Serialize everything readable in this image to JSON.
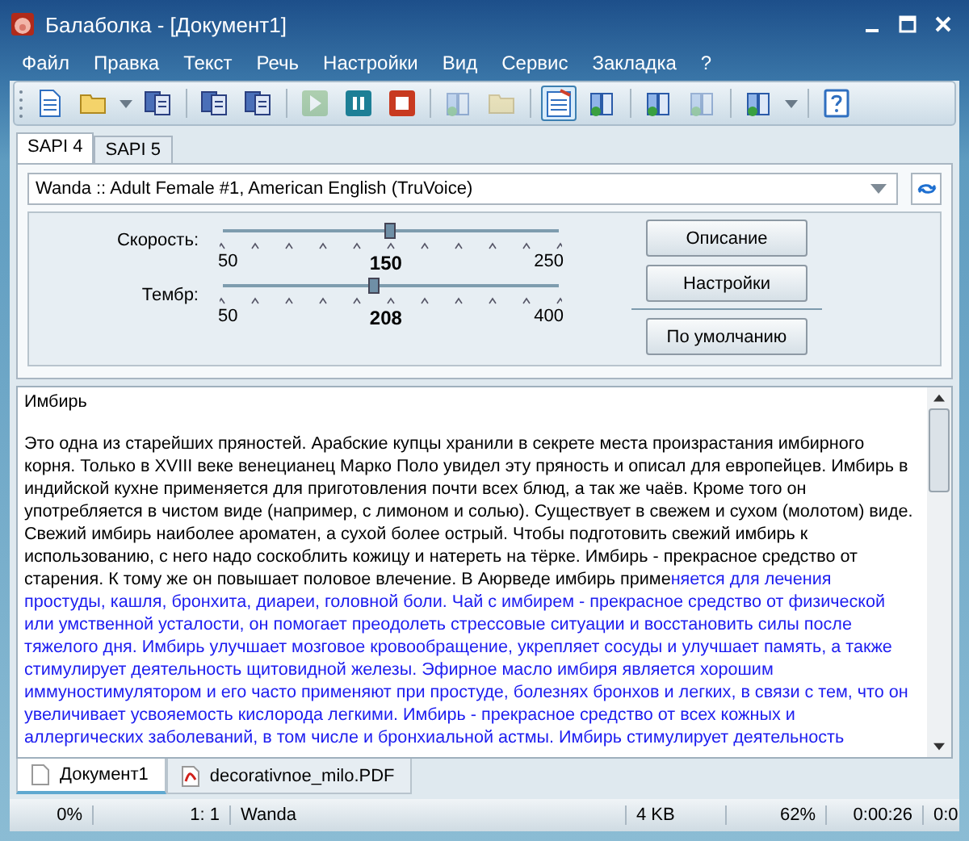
{
  "window": {
    "title": "Балаболка - [Документ1]"
  },
  "menu": [
    "Файл",
    "Правка",
    "Текст",
    "Речь",
    "Настройки",
    "Вид",
    "Сервис",
    "Закладка",
    "?"
  ],
  "toolbar": [
    {
      "kind": "page",
      "disabled": false,
      "selected": false
    },
    {
      "kind": "folder",
      "disabled": false,
      "selected": false
    },
    {
      "kind": "caret",
      "disabled": false
    },
    {
      "kind": "page-stack",
      "disabled": false,
      "selected": false
    },
    {
      "kind": "separator"
    },
    {
      "kind": "page-stack",
      "disabled": false,
      "selected": false
    },
    {
      "kind": "page-stack",
      "disabled": false,
      "selected": false
    },
    {
      "kind": "separator"
    },
    {
      "kind": "play",
      "disabled": true,
      "selected": false
    },
    {
      "kind": "pause",
      "disabled": false,
      "selected": false
    },
    {
      "kind": "stop",
      "disabled": false,
      "selected": false
    },
    {
      "kind": "separator"
    },
    {
      "kind": "book",
      "disabled": true,
      "selected": false
    },
    {
      "kind": "folder",
      "disabled": true,
      "selected": false
    },
    {
      "kind": "separator"
    },
    {
      "kind": "notepad",
      "disabled": false,
      "selected": true
    },
    {
      "kind": "book",
      "disabled": false,
      "selected": false
    },
    {
      "kind": "separator"
    },
    {
      "kind": "book",
      "disabled": false,
      "selected": false
    },
    {
      "kind": "book",
      "disabled": true,
      "selected": false
    },
    {
      "kind": "separator"
    },
    {
      "kind": "book",
      "disabled": false,
      "selected": false
    },
    {
      "kind": "caret",
      "disabled": false
    },
    {
      "kind": "separator"
    },
    {
      "kind": "help",
      "disabled": false,
      "selected": false
    }
  ],
  "engine_tabs": [
    {
      "label": "SAPI 4",
      "selected": true
    },
    {
      "label": "SAPI 5",
      "selected": false
    }
  ],
  "voice": {
    "value": "Wanda :: Adult Female #1, American English (TruVoice)"
  },
  "sliders": [
    {
      "label": "Скорость:",
      "min": "50",
      "max": "250",
      "reading": "150",
      "level": 0.5
    },
    {
      "label": "Тембр:",
      "min": "50",
      "max": "400",
      "reading": "208",
      "level": 0.45
    }
  ],
  "buttons": [
    "Описание",
    "Настройки",
    "По умолчанию"
  ],
  "editor": {
    "title": "Имбирь",
    "lines": [
      [
        {
          "text": "Это одна из старейших пряностей. Арабские купцы хранили в секрете места произрастания имбирного",
          "spoken": false
        }
      ],
      [
        {
          "text": "корня. Только в XVIII веке венецианец Марко Поло увидел эту пряность и описал для европейцев. Имбирь в",
          "spoken": false
        }
      ],
      [
        {
          "text": "индийской кухне применяется для приготовления почти всех блюд, а так же чаёв. Кроме того он",
          "spoken": false
        }
      ],
      [
        {
          "text": "употребляется в чистом виде (например, с лимоном и солью). Существует в свежем и сухом (молотом) виде.",
          "spoken": false
        }
      ],
      [
        {
          "text": "Свежий имбирь наиболее ароматен, а сухой более острый. Чтобы подготовить свежий имбирь к",
          "spoken": false
        }
      ],
      [
        {
          "text": "использованию, с него надо соскоблить кожицу и натереть на тёрке. Имбирь - прекрасное средство от",
          "spoken": false
        }
      ],
      [
        {
          "text": "старения. К тому же он повышает половое влечение. В Аюрведе имбирь приме",
          "spoken": false
        },
        {
          "text": "няется для лечения",
          "spoken": true
        }
      ],
      [
        {
          "text": "простуды, кашля, бронхита, диареи, головной боли. Чай с имбирем - прекрасное средство от физической",
          "spoken": true
        }
      ],
      [
        {
          "text": "или умственной усталости, он помогает преодолеть стрессовые ситуации и восстановить силы после",
          "spoken": true
        }
      ],
      [
        {
          "text": "тяжелого дня. Имбирь улучшает мозговое кровообращение, укрепляет сосуды и улучшает память, а также",
          "spoken": true
        }
      ],
      [
        {
          "text": "стимулирует деятельность щитовидной железы. Эфирное масло имбиря является хорошим",
          "spoken": true
        }
      ],
      [
        {
          "text": "иммуностимулятором и его часто применяют при простуде, болезнях бронхов и легких, в связи с тем, что он",
          "spoken": true
        }
      ],
      [
        {
          "text": "увеличивает усвояемость кислорода легкими. Имбирь - прекрасное средство от всех кожных и",
          "spoken": true
        }
      ],
      [
        {
          "text": "аллергических заболеваний, в том числе и бронхиальной астмы. Имбирь стимулирует деятельность",
          "spoken": true
        }
      ]
    ]
  },
  "doc_tabs": [
    {
      "label": "Документ1",
      "kind": "text",
      "selected": true
    },
    {
      "label": "decorativnoe_milo.PDF",
      "kind": "pdf",
      "selected": false
    }
  ],
  "status_bar": [
    "0%",
    "1:  1",
    "Wanda",
    "4 KB",
    "62%",
    "0:00:26",
    "0:0"
  ]
}
